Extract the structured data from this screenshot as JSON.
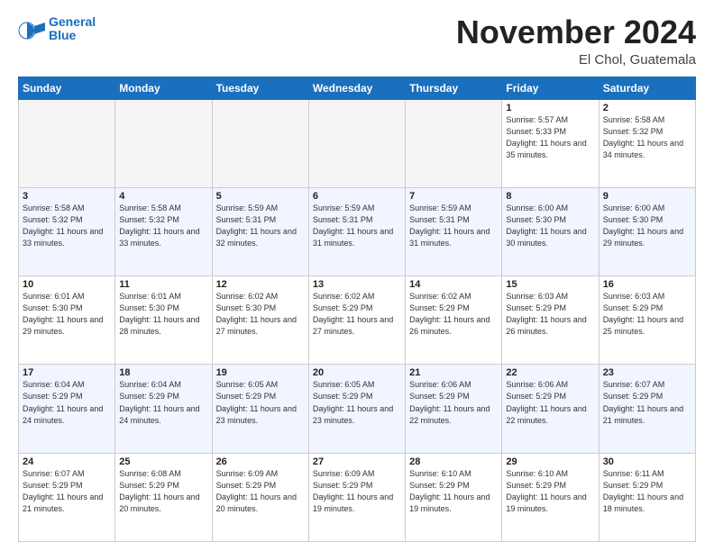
{
  "logo": {
    "line1": "General",
    "line2": "Blue"
  },
  "title": "November 2024",
  "subtitle": "El Chol, Guatemala",
  "days_of_week": [
    "Sunday",
    "Monday",
    "Tuesday",
    "Wednesday",
    "Thursday",
    "Friday",
    "Saturday"
  ],
  "weeks": [
    [
      {
        "day": "",
        "empty": true
      },
      {
        "day": "",
        "empty": true
      },
      {
        "day": "",
        "empty": true
      },
      {
        "day": "",
        "empty": true
      },
      {
        "day": "",
        "empty": true
      },
      {
        "day": "1",
        "info": "Sunrise: 5:57 AM\nSunset: 5:33 PM\nDaylight: 11 hours\nand 35 minutes."
      },
      {
        "day": "2",
        "info": "Sunrise: 5:58 AM\nSunset: 5:32 PM\nDaylight: 11 hours\nand 34 minutes."
      }
    ],
    [
      {
        "day": "3",
        "info": "Sunrise: 5:58 AM\nSunset: 5:32 PM\nDaylight: 11 hours\nand 33 minutes."
      },
      {
        "day": "4",
        "info": "Sunrise: 5:58 AM\nSunset: 5:32 PM\nDaylight: 11 hours\nand 33 minutes."
      },
      {
        "day": "5",
        "info": "Sunrise: 5:59 AM\nSunset: 5:31 PM\nDaylight: 11 hours\nand 32 minutes."
      },
      {
        "day": "6",
        "info": "Sunrise: 5:59 AM\nSunset: 5:31 PM\nDaylight: 11 hours\nand 31 minutes."
      },
      {
        "day": "7",
        "info": "Sunrise: 5:59 AM\nSunset: 5:31 PM\nDaylight: 11 hours\nand 31 minutes."
      },
      {
        "day": "8",
        "info": "Sunrise: 6:00 AM\nSunset: 5:30 PM\nDaylight: 11 hours\nand 30 minutes."
      },
      {
        "day": "9",
        "info": "Sunrise: 6:00 AM\nSunset: 5:30 PM\nDaylight: 11 hours\nand 29 minutes."
      }
    ],
    [
      {
        "day": "10",
        "info": "Sunrise: 6:01 AM\nSunset: 5:30 PM\nDaylight: 11 hours\nand 29 minutes."
      },
      {
        "day": "11",
        "info": "Sunrise: 6:01 AM\nSunset: 5:30 PM\nDaylight: 11 hours\nand 28 minutes."
      },
      {
        "day": "12",
        "info": "Sunrise: 6:02 AM\nSunset: 5:30 PM\nDaylight: 11 hours\nand 27 minutes."
      },
      {
        "day": "13",
        "info": "Sunrise: 6:02 AM\nSunset: 5:29 PM\nDaylight: 11 hours\nand 27 minutes."
      },
      {
        "day": "14",
        "info": "Sunrise: 6:02 AM\nSunset: 5:29 PM\nDaylight: 11 hours\nand 26 minutes."
      },
      {
        "day": "15",
        "info": "Sunrise: 6:03 AM\nSunset: 5:29 PM\nDaylight: 11 hours\nand 26 minutes."
      },
      {
        "day": "16",
        "info": "Sunrise: 6:03 AM\nSunset: 5:29 PM\nDaylight: 11 hours\nand 25 minutes."
      }
    ],
    [
      {
        "day": "17",
        "info": "Sunrise: 6:04 AM\nSunset: 5:29 PM\nDaylight: 11 hours\nand 24 minutes."
      },
      {
        "day": "18",
        "info": "Sunrise: 6:04 AM\nSunset: 5:29 PM\nDaylight: 11 hours\nand 24 minutes."
      },
      {
        "day": "19",
        "info": "Sunrise: 6:05 AM\nSunset: 5:29 PM\nDaylight: 11 hours\nand 23 minutes."
      },
      {
        "day": "20",
        "info": "Sunrise: 6:05 AM\nSunset: 5:29 PM\nDaylight: 11 hours\nand 23 minutes."
      },
      {
        "day": "21",
        "info": "Sunrise: 6:06 AM\nSunset: 5:29 PM\nDaylight: 11 hours\nand 22 minutes."
      },
      {
        "day": "22",
        "info": "Sunrise: 6:06 AM\nSunset: 5:29 PM\nDaylight: 11 hours\nand 22 minutes."
      },
      {
        "day": "23",
        "info": "Sunrise: 6:07 AM\nSunset: 5:29 PM\nDaylight: 11 hours\nand 21 minutes."
      }
    ],
    [
      {
        "day": "24",
        "info": "Sunrise: 6:07 AM\nSunset: 5:29 PM\nDaylight: 11 hours\nand 21 minutes."
      },
      {
        "day": "25",
        "info": "Sunrise: 6:08 AM\nSunset: 5:29 PM\nDaylight: 11 hours\nand 20 minutes."
      },
      {
        "day": "26",
        "info": "Sunrise: 6:09 AM\nSunset: 5:29 PM\nDaylight: 11 hours\nand 20 minutes."
      },
      {
        "day": "27",
        "info": "Sunrise: 6:09 AM\nSunset: 5:29 PM\nDaylight: 11 hours\nand 19 minutes."
      },
      {
        "day": "28",
        "info": "Sunrise: 6:10 AM\nSunset: 5:29 PM\nDaylight: 11 hours\nand 19 minutes."
      },
      {
        "day": "29",
        "info": "Sunrise: 6:10 AM\nSunset: 5:29 PM\nDaylight: 11 hours\nand 19 minutes."
      },
      {
        "day": "30",
        "info": "Sunrise: 6:11 AM\nSunset: 5:29 PM\nDaylight: 11 hours\nand 18 minutes."
      }
    ]
  ]
}
